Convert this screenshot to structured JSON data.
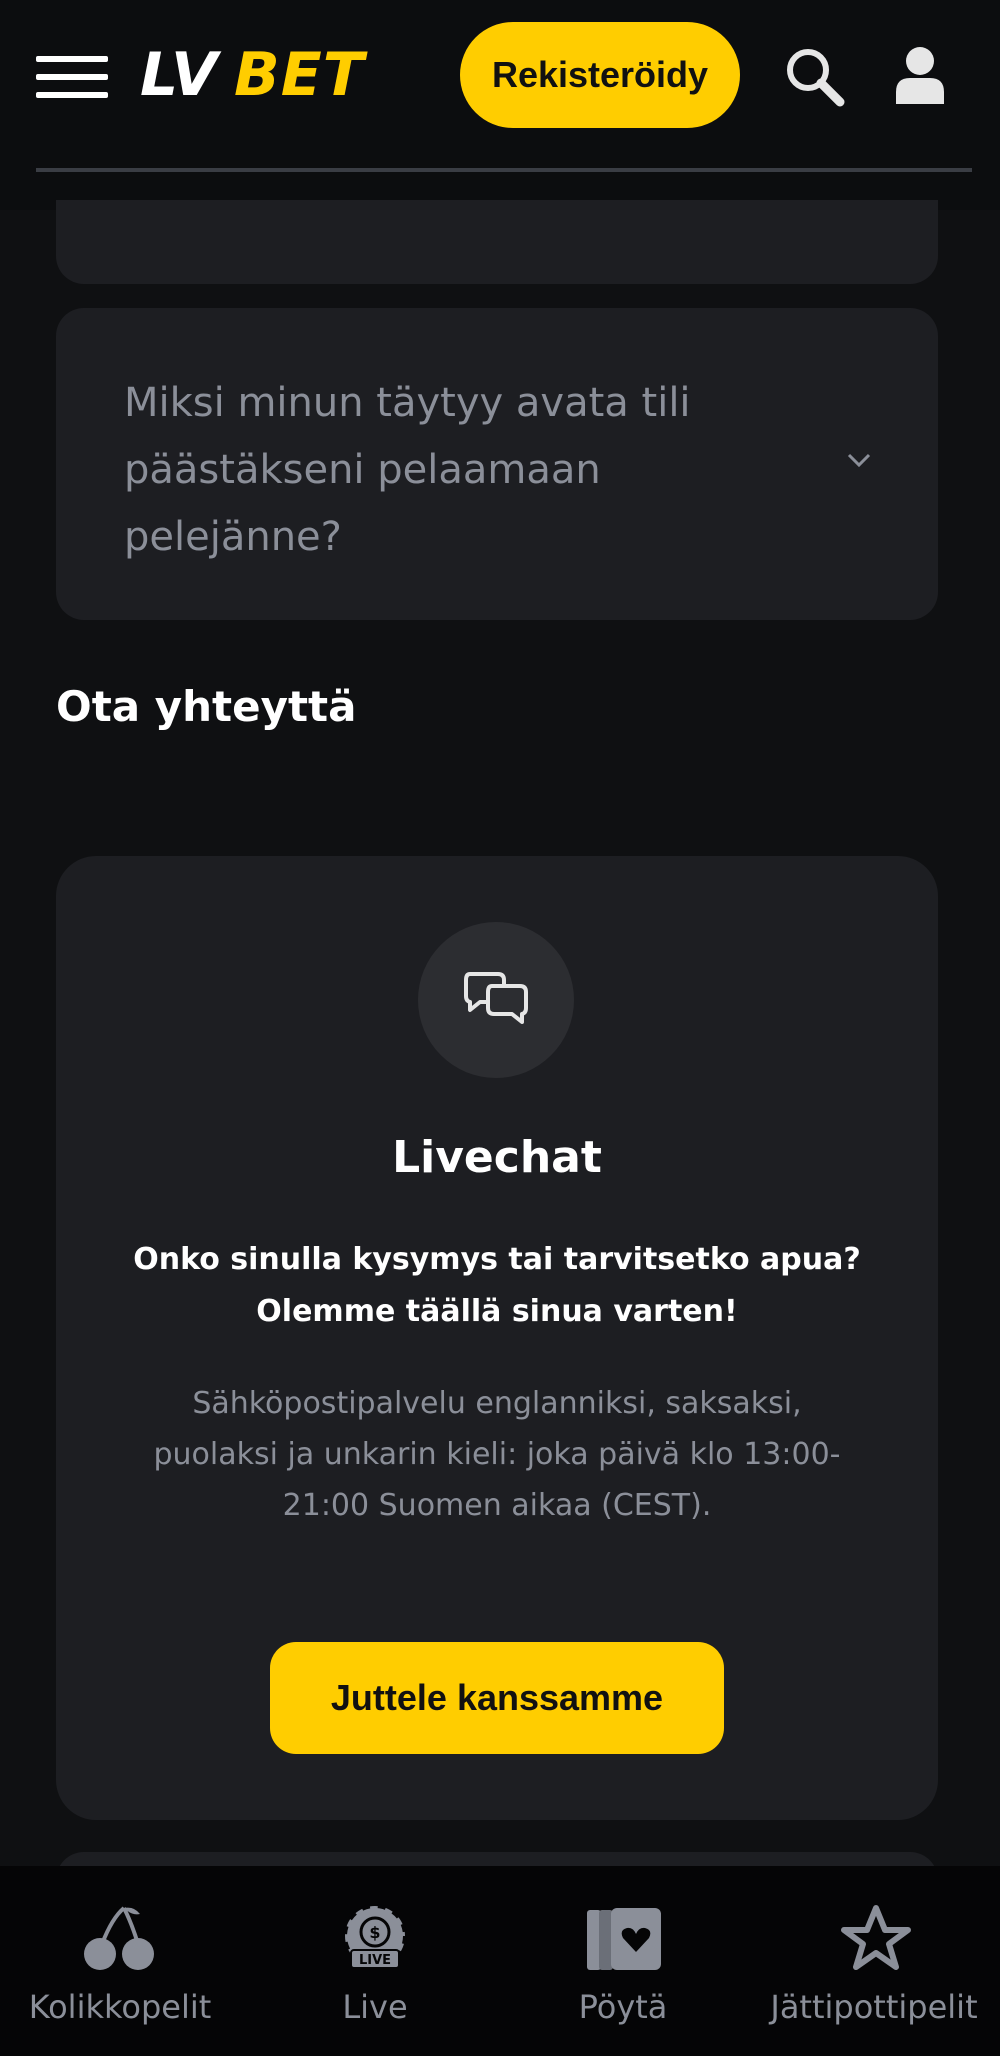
{
  "header": {
    "logo_lv": "LV",
    "logo_bet": "BET",
    "register_label": "Rekisteröidy"
  },
  "faq": {
    "question": "Miksi minun täytyy avata tili päästäkseni pelaamaan pelejänne?"
  },
  "contact": {
    "section_title": "Ota yhteyttä",
    "title": "Livechat",
    "subtitle": "Onko sinulla kysymys tai tarvitsetko apua? Olemme täällä sinua varten!",
    "description": "Sähköpostipalvelu englanniksi, saksaksi, puolaksi ja unkarin kieli: joka päivä klo 13:00-21:00 Suomen aikaa (CEST).",
    "button_label": "Juttele kanssamme"
  },
  "bottom_nav": {
    "items": [
      {
        "label": "Kolikkopelit",
        "icon": "cherries-icon"
      },
      {
        "label": "Live",
        "icon": "live-chip-icon"
      },
      {
        "label": "Pöytä",
        "icon": "cards-icon"
      },
      {
        "label": "Jättipottipelit",
        "icon": "star-icon"
      }
    ]
  },
  "colors": {
    "accent": "#ffcd00",
    "background": "#0f1012",
    "card": "#1d1e22",
    "muted_text": "#8b8f99"
  }
}
